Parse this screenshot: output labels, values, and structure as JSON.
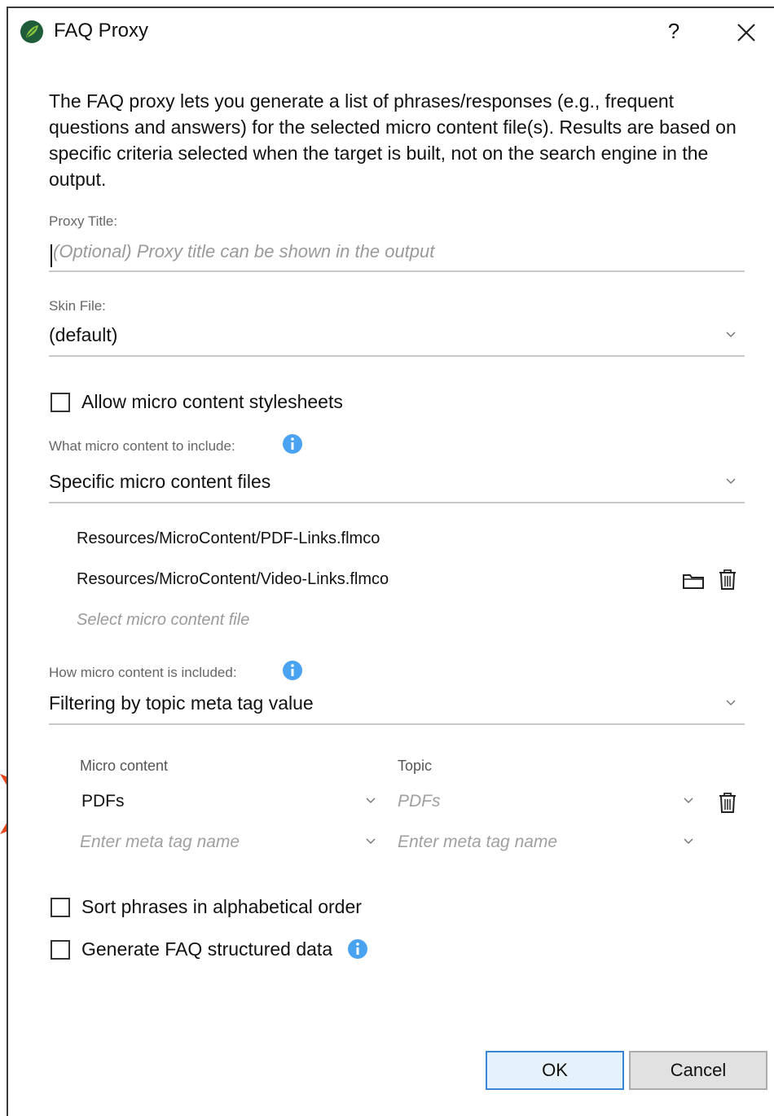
{
  "window": {
    "title": "FAQ Proxy",
    "help_label": "?"
  },
  "description": "The FAQ proxy lets you generate a list of phrases/responses (e.g., frequent questions and answers) for the selected micro content file(s). Results are based on specific criteria selected when the target is built, not on the search engine in the output.",
  "proxy_title": {
    "label": "Proxy Title:",
    "value": "",
    "placeholder": "(Optional) Proxy title can be shown in the output"
  },
  "skin_file": {
    "label": "Skin File:",
    "value": "(default)"
  },
  "allow_stylesheets": {
    "label": "Allow micro content stylesheets",
    "checked": false
  },
  "what_content": {
    "label": "What micro content to include:",
    "value": "Specific micro content files",
    "files": [
      "Resources/MicroContent/PDF-Links.flmco",
      "Resources/MicroContent/Video-Links.flmco"
    ],
    "add_placeholder": "Select micro content file"
  },
  "how_included": {
    "label": "How micro content is included:",
    "value": "Filtering by topic meta tag value"
  },
  "mapping": {
    "col_micro": "Micro content",
    "col_topic": "Topic",
    "rows": [
      {
        "micro": "PDFs",
        "topic": "PDFs"
      }
    ],
    "new_micro_placeholder": "Enter meta tag name",
    "new_topic_placeholder": "Enter meta tag name"
  },
  "sort_phrases": {
    "label": "Sort phrases in alphabetical order",
    "checked": false
  },
  "generate_faq": {
    "label": "Generate FAQ structured data",
    "checked": false
  },
  "buttons": {
    "ok": "OK",
    "cancel": "Cancel"
  },
  "colors": {
    "accent_arrow": "#e8461c",
    "info_blue": "#4aa3f0",
    "ok_border": "#3b86d6"
  }
}
